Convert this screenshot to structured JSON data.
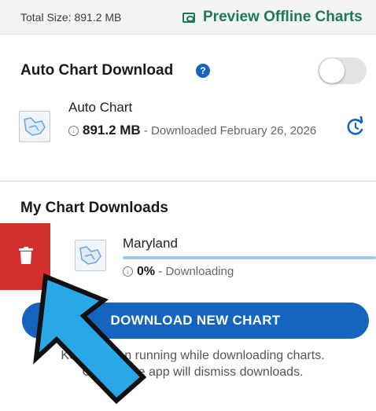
{
  "header": {
    "total_size": "Total Size: 891.2 MB",
    "preview_label": "Preview Offline Charts",
    "preview_icon": "map-preview-icon"
  },
  "auto_section": {
    "title": "Auto Chart Download",
    "help_icon": "question-icon",
    "help_glyph": "?",
    "toggle_on": false,
    "item": {
      "name": "Auto Chart",
      "size": "891.2 MB",
      "status": " - Downloaded February 26, 2026",
      "refresh_icon": "refresh-icon"
    }
  },
  "my_section": {
    "title": "My Chart Downloads",
    "items": [
      {
        "name": "Maryland",
        "percent": "0%",
        "status": " - Downloading",
        "progress": 0,
        "delete_icon": "trash-icon"
      }
    ]
  },
  "download_button": {
    "label": "DOWNLOAD NEW CHART"
  },
  "note": {
    "line1": "Keep screen running while downloading charts.",
    "line2": "Closing the app will dismiss downloads."
  },
  "colors": {
    "accent_green": "#1c7a5a",
    "primary_blue": "#1565c0",
    "delete_red": "#d32f2f",
    "arrow_blue": "#29a8e8"
  }
}
